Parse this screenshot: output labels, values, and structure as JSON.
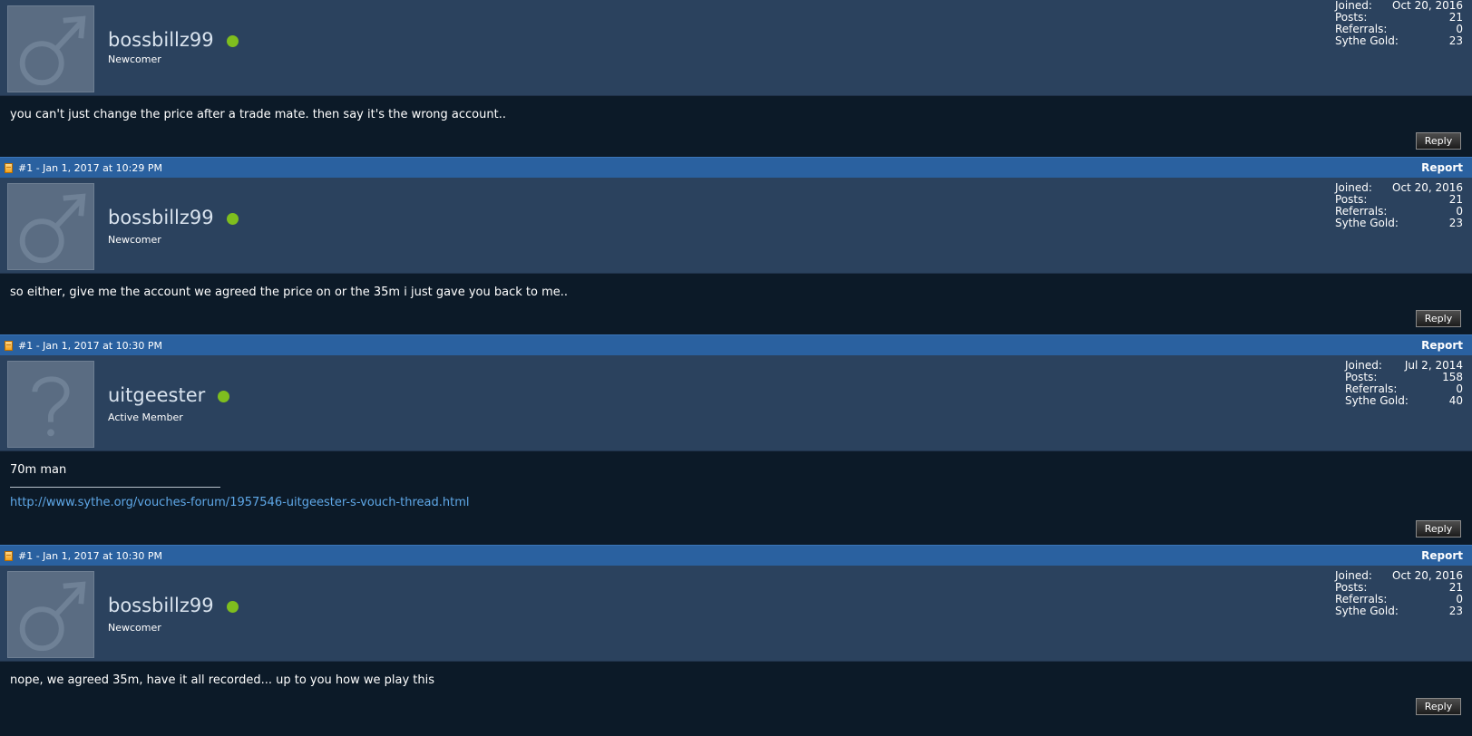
{
  "posts": [
    {
      "header": null,
      "user": {
        "name": "bossbillz99",
        "title": "Newcomer",
        "avatar": "male-icon"
      },
      "stats": {
        "joined_label": "Joined:",
        "joined": "Oct 20, 2016",
        "posts_label": "Posts:",
        "posts": "21",
        "referrals_label": "Referrals:",
        "referrals": "0",
        "gold_label": "Sythe Gold:",
        "gold": "23"
      },
      "body": "you can't just change the price after a trade mate. then say it's the wrong account..",
      "reply": "Reply"
    },
    {
      "header": {
        "label": "#1 - Jan 1, 2017 at 10:29 PM",
        "report": "Report"
      },
      "user": {
        "name": "bossbillz99",
        "title": "Newcomer",
        "avatar": "male-icon"
      },
      "stats": {
        "joined_label": "Joined:",
        "joined": "Oct 20, 2016",
        "posts_label": "Posts:",
        "posts": "21",
        "referrals_label": "Referrals:",
        "referrals": "0",
        "gold_label": "Sythe Gold:",
        "gold": "23"
      },
      "body": "so either, give me the account we agreed the price on or the 35m i just gave you back to me..",
      "reply": "Reply"
    },
    {
      "header": {
        "label": "#1 - Jan 1, 2017 at 10:30 PM",
        "report": "Report"
      },
      "user": {
        "name": "uitgeester",
        "title": "Active Member",
        "avatar": "unknown-icon"
      },
      "stats": {
        "joined_label": "Joined:",
        "joined": "Jul 2, 2014",
        "posts_label": "Posts:",
        "posts": "158",
        "referrals_label": "Referrals:",
        "referrals": "0",
        "gold_label": "Sythe Gold:",
        "gold": "40"
      },
      "body": "70m man",
      "signature_link": "http://www.sythe.org/vouches-forum/1957546-uitgeester-s-vouch-thread.html",
      "reply": "Reply"
    },
    {
      "header": {
        "label": "#1 - Jan 1, 2017 at 10:30 PM",
        "report": "Report"
      },
      "user": {
        "name": "bossbillz99",
        "title": "Newcomer",
        "avatar": "male-icon"
      },
      "stats": {
        "joined_label": "Joined:",
        "joined": "Oct 20, 2016",
        "posts_label": "Posts:",
        "posts": "21",
        "referrals_label": "Referrals:",
        "referrals": "0",
        "gold_label": "Sythe Gold:",
        "gold": "23"
      },
      "body": "nope, we agreed 35m, have it all recorded... up to you how we play this",
      "reply": "Reply"
    }
  ],
  "colors": {
    "header_bar": "#2a61a0",
    "user_panel": "#2b425e",
    "body_bg": "#0c1a28",
    "online": "#7fbe1e",
    "link": "#5fa8e8"
  }
}
